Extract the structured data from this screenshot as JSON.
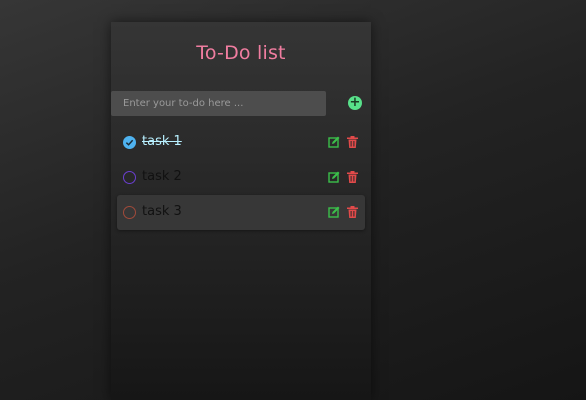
{
  "app": {
    "title": "To-Do list"
  },
  "input": {
    "placeholder": "Enter your to-do here ...",
    "value": ""
  },
  "add_button": {
    "icon": "plus-circle-icon",
    "label": "+"
  },
  "colors": {
    "title": "#f07da0",
    "add": "#58e08a",
    "edit": "#3bbf4a",
    "delete": "#e24a4a",
    "done": "#4fb3f0"
  },
  "tasks": [
    {
      "label": "task 1",
      "done": true,
      "check_color": "#4fb3f0"
    },
    {
      "label": "task 2",
      "done": false,
      "check_color": "#6a3fd0"
    },
    {
      "label": "task 3",
      "done": false,
      "check_color": "#a04a3a"
    }
  ]
}
